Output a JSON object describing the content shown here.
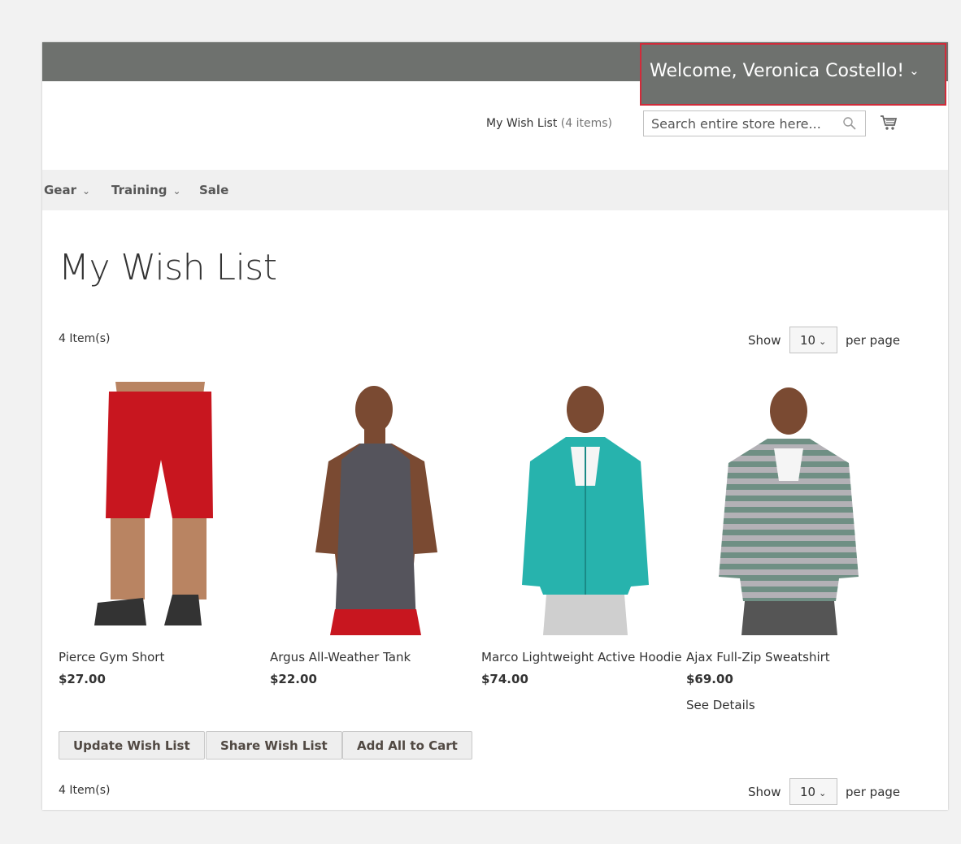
{
  "header": {
    "welcome": "Welcome, Veronica Costello!",
    "wishlist_link_label": "My Wish List",
    "wishlist_link_count": "(4 items)",
    "search_placeholder": "Search entire store here..."
  },
  "nav": [
    {
      "label": "Gear",
      "has_dropdown": true
    },
    {
      "label": "Training",
      "has_dropdown": true
    },
    {
      "label": "Sale",
      "has_dropdown": false
    }
  ],
  "page_title": "My Wish List",
  "toolbar": {
    "count": "4 Item(s)",
    "show_label": "Show",
    "limit": "10",
    "per_page_label": "per page"
  },
  "products": [
    {
      "name": "Pierce Gym Short",
      "price": "$27.00",
      "image": "red-shorts"
    },
    {
      "name": "Argus All-Weather Tank",
      "price": "$22.00",
      "image": "gray-tank"
    },
    {
      "name": "Marco Lightweight Active Hoodie",
      "price": "$74.00",
      "image": "teal-hoodie"
    },
    {
      "name": "Ajax Full-Zip Sweatshirt",
      "price": "$69.00",
      "image": "striped-sweatshirt",
      "details_label": "See Details"
    }
  ],
  "actions": {
    "update": "Update Wish List",
    "share": "Share Wish List",
    "add_all": "Add All to Cart"
  },
  "colors": {
    "top_bar": "#6e716e",
    "welcome_highlight_border": "#d12b3a",
    "nav_bg": "#f0f0f0"
  }
}
